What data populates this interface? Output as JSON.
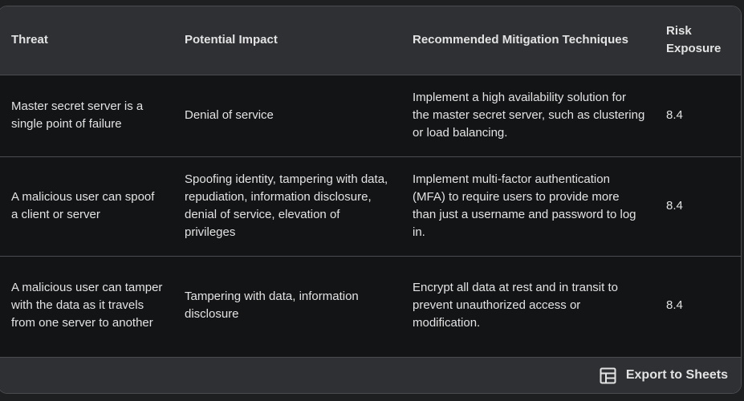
{
  "table": {
    "headers": {
      "threat": "Threat",
      "impact": "Potential Impact",
      "mitigation": "Recommended Mitigation Techniques",
      "risk": "Risk Exposure"
    },
    "rows": [
      {
        "threat": "Master secret server is a single point of failure",
        "impact": "Denial of service",
        "mitigation": "Implement a high availability solution for the master secret server, such as clustering or load balancing.",
        "risk": "8.4"
      },
      {
        "threat": "A malicious user can spoof a client or server",
        "impact": "Spoofing identity, tampering with data, repudiation, information disclosure, denial of service, elevation of privileges",
        "mitigation": "Implement multi-factor authentication (MFA) to require users to provide more than just a username and password to log in.",
        "risk": "8.4"
      },
      {
        "threat": "A malicious user can tamper with the data as it travels from one server to another",
        "impact": "Tampering with data, information disclosure",
        "mitigation": "Encrypt all data at rest and in transit to prevent unauthorized access or modification.",
        "risk": "8.4"
      }
    ]
  },
  "footer": {
    "export_label": "Export to Sheets",
    "export_icon": "table-grid-icon"
  }
}
